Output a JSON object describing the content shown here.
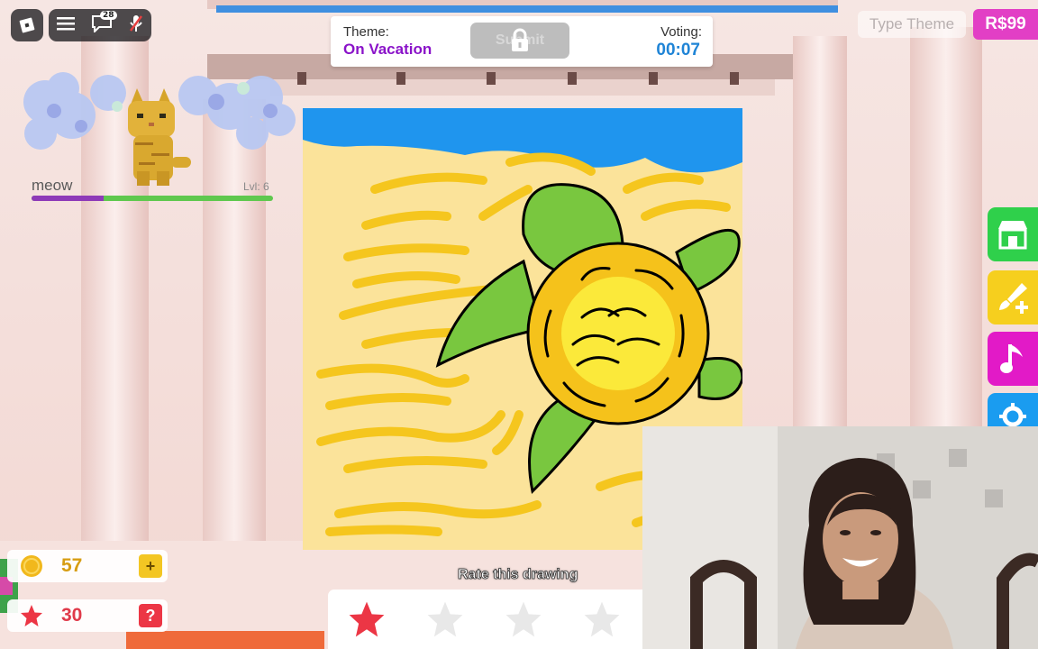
{
  "roblox": {
    "chat_count": "28"
  },
  "theme": {
    "label": "Theme:",
    "value": "On Vacation"
  },
  "submit": {
    "label": "Submit"
  },
  "voting": {
    "label": "Voting:",
    "timer": "00:07"
  },
  "type_theme": {
    "placeholder": "Type Theme"
  },
  "robux": {
    "label": "R$99"
  },
  "pet": {
    "name": "meow",
    "level": "Lvl: 6",
    "xp_progress": 0.3
  },
  "currency": {
    "coins": "57",
    "stars": "30"
  },
  "rating": {
    "prompt": "Rate this drawing",
    "selected": 1,
    "max": 4
  },
  "side_buttons": [
    "shop-icon",
    "paintbrush-plus-icon",
    "music-note-icon",
    "gear-icon"
  ],
  "colors": {
    "theme_purple": "#8a13c9",
    "timer_blue": "#1f84d6",
    "robux_pink": "#e23fc5",
    "coin_gold": "#f1b81c",
    "star_red": "#ec3645",
    "shop_green": "#2fd04b",
    "brush_yellow": "#f6cf1e",
    "music_magenta": "#e21ac7"
  }
}
